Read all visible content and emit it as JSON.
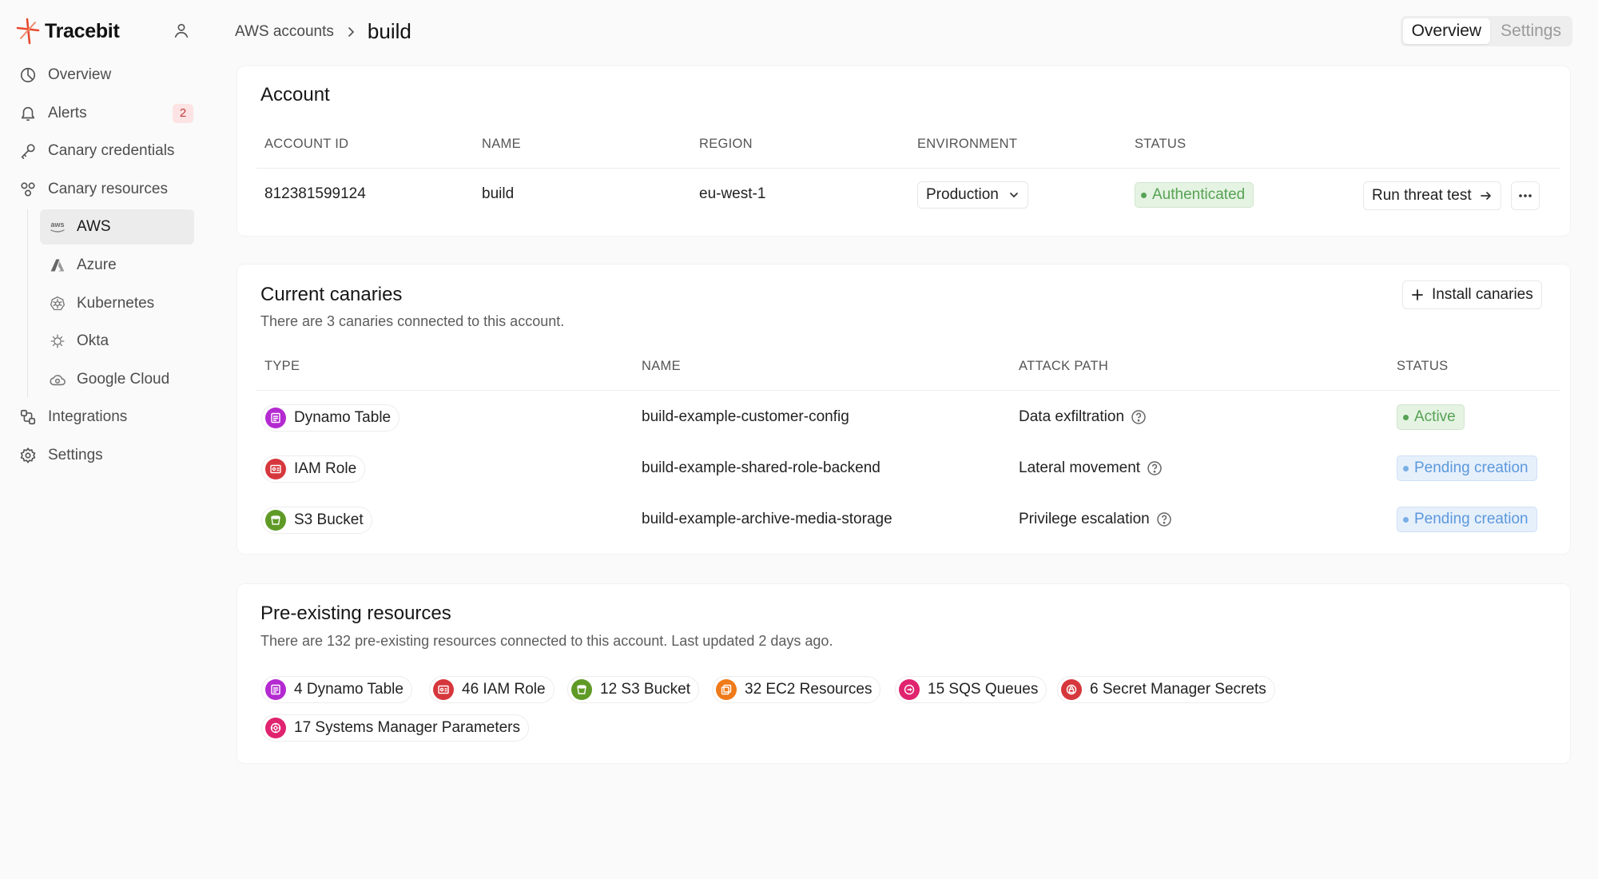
{
  "brand": {
    "name": "Tracebit"
  },
  "sidebar": {
    "items": [
      {
        "label": "Overview",
        "icon": "chart-pie-icon"
      },
      {
        "label": "Alerts",
        "icon": "bell-icon",
        "badge": "2"
      },
      {
        "label": "Canary credentials",
        "icon": "key-icon"
      },
      {
        "label": "Canary resources",
        "icon": "shapes-icon"
      }
    ],
    "sub_items": [
      {
        "label": "AWS",
        "icon": "aws-icon",
        "active": true
      },
      {
        "label": "Azure",
        "icon": "azure-icon"
      },
      {
        "label": "Kubernetes",
        "icon": "kubernetes-icon"
      },
      {
        "label": "Okta",
        "icon": "okta-icon"
      },
      {
        "label": "Google Cloud",
        "icon": "cloud-icon"
      }
    ],
    "bottom_items": [
      {
        "label": "Integrations",
        "icon": "integrations-icon"
      },
      {
        "label": "Settings",
        "icon": "gear-icon"
      }
    ]
  },
  "breadcrumb": {
    "parent": "AWS accounts",
    "current": "build"
  },
  "tabs": [
    {
      "label": "Overview",
      "active": true
    },
    {
      "label": "Settings",
      "active": false
    }
  ],
  "account": {
    "title": "Account",
    "headers": [
      "ACCOUNT ID",
      "NAME",
      "REGION",
      "ENVIRONMENT",
      "STATUS"
    ],
    "row": {
      "account_id": "812381599124",
      "name": "build",
      "region": "eu-west-1",
      "environment": "Production",
      "status": "Authenticated"
    },
    "run_threat_test": "Run threat test"
  },
  "canaries": {
    "title": "Current canaries",
    "subtitle": "There are 3 canaries connected to this account.",
    "install_label": "Install canaries",
    "headers": [
      "TYPE",
      "NAME",
      "ATTACK PATH",
      "STATUS"
    ],
    "rows": [
      {
        "type": "Dynamo Table",
        "type_color": "#b42ad1",
        "name": "build-example-customer-config",
        "attack_path": "Data exfiltration",
        "status": "Active",
        "status_kind": "green"
      },
      {
        "type": "IAM Role",
        "type_color": "#d6373c",
        "name": "build-example-shared-role-backend",
        "attack_path": "Lateral movement",
        "status": "Pending creation",
        "status_kind": "blue"
      },
      {
        "type": "S3 Bucket",
        "type_color": "#5f9a26",
        "name": "build-example-archive-media-storage",
        "attack_path": "Privilege escalation",
        "status": "Pending creation",
        "status_kind": "blue"
      }
    ]
  },
  "preexisting": {
    "title": "Pre-existing resources",
    "subtitle": "There are 132 pre-existing resources connected to this account. Last updated 2 days ago.",
    "items": [
      {
        "label": "4 Dynamo Table",
        "color": "#b42ad1"
      },
      {
        "label": "46 IAM Role",
        "color": "#d6373c"
      },
      {
        "label": "12 S3 Bucket",
        "color": "#5f9a26"
      },
      {
        "label": "32 EC2 Resources",
        "color": "#ef7a1a"
      },
      {
        "label": "15 SQS Queues",
        "color": "#e0246f"
      },
      {
        "label": "6 Secret Manager Secrets",
        "color": "#d6373c"
      },
      {
        "label": "17 Systems Manager Parameters",
        "color": "#e0246f"
      }
    ]
  }
}
